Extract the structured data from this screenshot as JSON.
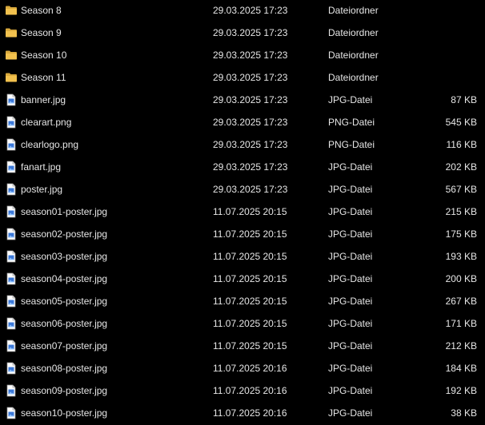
{
  "colors": {
    "background": "#000000",
    "text": "#e6e6e6",
    "folder": "#f2c14e",
    "file_icon_accent": "#3b78d8"
  },
  "files": [
    {
      "name": "Season 8",
      "date": "29.03.2025 17:23",
      "type": "Dateiordner",
      "size": "",
      "icon": "folder-icon"
    },
    {
      "name": "Season 9",
      "date": "29.03.2025 17:23",
      "type": "Dateiordner",
      "size": "",
      "icon": "folder-icon"
    },
    {
      "name": "Season 10",
      "date": "29.03.2025 17:23",
      "type": "Dateiordner",
      "size": "",
      "icon": "folder-icon"
    },
    {
      "name": "Season 11",
      "date": "29.03.2025 17:23",
      "type": "Dateiordner",
      "size": "",
      "icon": "folder-icon"
    },
    {
      "name": "banner.jpg",
      "date": "29.03.2025 17:23",
      "type": "JPG-Datei",
      "size": "87 KB",
      "icon": "image-file-icon"
    },
    {
      "name": "clearart.png",
      "date": "29.03.2025 17:23",
      "type": "PNG-Datei",
      "size": "545 KB",
      "icon": "image-file-icon"
    },
    {
      "name": "clearlogo.png",
      "date": "29.03.2025 17:23",
      "type": "PNG-Datei",
      "size": "116 KB",
      "icon": "image-file-icon"
    },
    {
      "name": "fanart.jpg",
      "date": "29.03.2025 17:23",
      "type": "JPG-Datei",
      "size": "202 KB",
      "icon": "image-file-icon"
    },
    {
      "name": "poster.jpg",
      "date": "29.03.2025 17:23",
      "type": "JPG-Datei",
      "size": "567 KB",
      "icon": "image-file-icon"
    },
    {
      "name": "season01-poster.jpg",
      "date": "11.07.2025 20:15",
      "type": "JPG-Datei",
      "size": "215 KB",
      "icon": "image-file-icon"
    },
    {
      "name": "season02-poster.jpg",
      "date": "11.07.2025 20:15",
      "type": "JPG-Datei",
      "size": "175 KB",
      "icon": "image-file-icon"
    },
    {
      "name": "season03-poster.jpg",
      "date": "11.07.2025 20:15",
      "type": "JPG-Datei",
      "size": "193 KB",
      "icon": "image-file-icon"
    },
    {
      "name": "season04-poster.jpg",
      "date": "11.07.2025 20:15",
      "type": "JPG-Datei",
      "size": "200 KB",
      "icon": "image-file-icon"
    },
    {
      "name": "season05-poster.jpg",
      "date": "11.07.2025 20:15",
      "type": "JPG-Datei",
      "size": "267 KB",
      "icon": "image-file-icon"
    },
    {
      "name": "season06-poster.jpg",
      "date": "11.07.2025 20:15",
      "type": "JPG-Datei",
      "size": "171 KB",
      "icon": "image-file-icon"
    },
    {
      "name": "season07-poster.jpg",
      "date": "11.07.2025 20:15",
      "type": "JPG-Datei",
      "size": "212 KB",
      "icon": "image-file-icon"
    },
    {
      "name": "season08-poster.jpg",
      "date": "11.07.2025 20:16",
      "type": "JPG-Datei",
      "size": "184 KB",
      "icon": "image-file-icon"
    },
    {
      "name": "season09-poster.jpg",
      "date": "11.07.2025 20:16",
      "type": "JPG-Datei",
      "size": "192 KB",
      "icon": "image-file-icon"
    },
    {
      "name": "season10-poster.jpg",
      "date": "11.07.2025 20:16",
      "type": "JPG-Datei",
      "size": "38 KB",
      "icon": "image-file-icon"
    }
  ]
}
